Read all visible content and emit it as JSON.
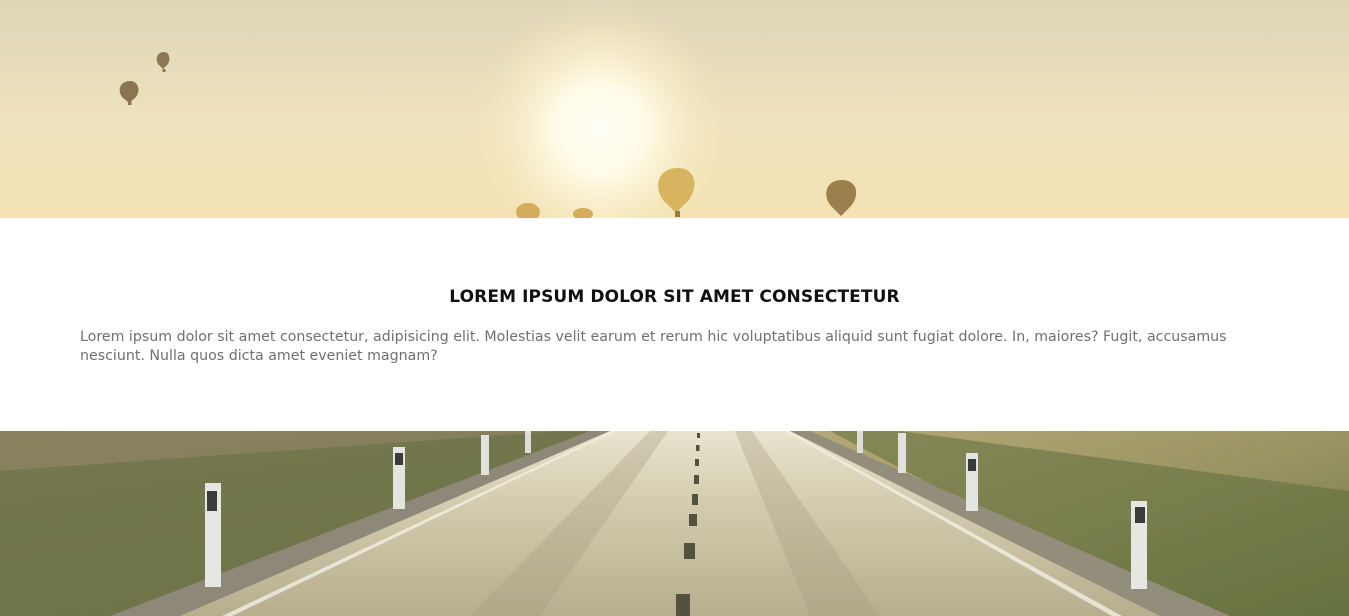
{
  "hero_top": {
    "image": "sunrise-sky-with-hot-air-balloons",
    "colors": {
      "sky_top": "#d9d1ad",
      "sky_mid": "#efe3bf",
      "sun": "#fffdf2",
      "balloon": "#8f7a54",
      "balloon_gold": "#d9b565"
    }
  },
  "content": {
    "heading": "LOREM IPSUM DOLOR SIT AMET CONSECTETUR",
    "body": "Lorem ipsum dolor sit amet consectetur, adipisicing elit. Molestias velit earum et rerum hic voluptatibus aliquid sunt fugiat dolore. In, maiores? Fugit, accusamus nesciunt. Nulla quos dicta amet eveniet magnam?"
  },
  "hero_bottom": {
    "image": "empty-country-road-through-fields",
    "colors": {
      "road": "#c9c1a4",
      "field": "#7f7a55",
      "grass": "#5f6e3e",
      "post": "#e8e8e8"
    }
  }
}
